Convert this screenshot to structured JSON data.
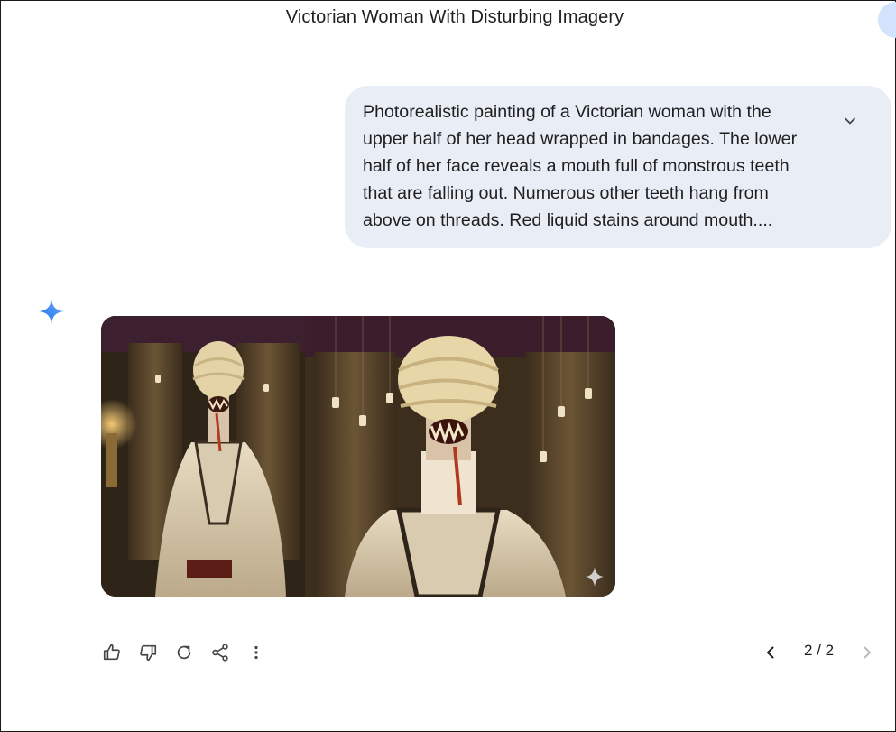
{
  "conversation": {
    "title": "Victorian Woman With Disturbing Imagery"
  },
  "user_message": {
    "text": "Photorealistic painting of a Victorian woman with the upper half of her head wrapped in bandages. The lower half of her face reveals a mouth full of monstrous teeth that are falling out. Numerous other teeth hang from above on threads. Red liquid stains around mouth...."
  },
  "response": {
    "pager": "2 / 2"
  },
  "colors": {
    "bubble": "#e9eef6",
    "spark_blue": "#4285f4",
    "icon": "#444746",
    "avatar": "#d3e3fd"
  },
  "icons": {
    "expand": "chevron-down-icon",
    "assistant": "sparkle-icon",
    "like": "thumbs-up-icon",
    "dislike": "thumbs-down-icon",
    "regenerate": "refresh-icon",
    "share": "share-icon",
    "more": "more-vert-icon",
    "prev": "chevron-left-icon",
    "next": "chevron-right-icon"
  }
}
